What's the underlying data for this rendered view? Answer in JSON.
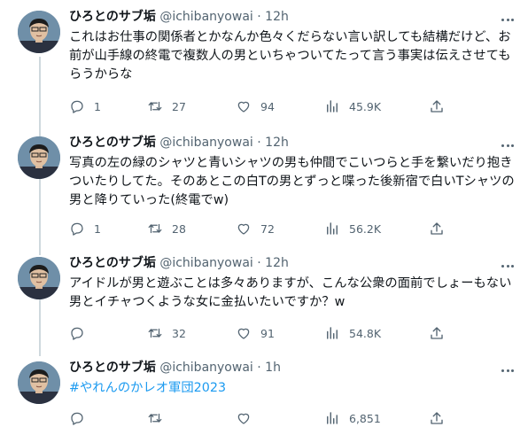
{
  "tweets": [
    {
      "name": "ひろとのサブ垢",
      "handle": "@ichibanyowai",
      "sep": "·",
      "time": "12h",
      "paragraphs": [
        "これはお仕事の関係者とかなんか色々くだらない言い訳しても結構だけど、お前が山手線の終電で複数人の男といちゃついてたって言う事実は伝えさせてもらうからな"
      ],
      "replies": "1",
      "retweets": "27",
      "likes": "94",
      "views": "45.9K"
    },
    {
      "name": "ひろとのサブ垢",
      "handle": "@ichibanyowai",
      "sep": "·",
      "time": "12h",
      "paragraphs": [
        "写真の左の緑のシャツと青いシャツの男も仲間でこいつらと手を繋いだり抱きついたりしてた。そのあとこの白Tの男とずっと喋った後新宿で白いTシャツの男と降りていった(終電でw)"
      ],
      "replies": "1",
      "retweets": "28",
      "likes": "72",
      "views": "56.2K"
    },
    {
      "name": "ひろとのサブ垢",
      "handle": "@ichibanyowai",
      "sep": "·",
      "time": "12h",
      "paragraphs": [
        "アイドルが男と遊ぶことは多々ありますが、こんな公衆の面前でしょーもない男とイチャつくような女に金払いたいですか？w"
      ],
      "replies": "",
      "retweets": "32",
      "likes": "91",
      "views": "54.8K"
    },
    {
      "name": "ひろとのサブ垢",
      "handle": "@ichibanyowai",
      "sep": "·",
      "time": "1h",
      "hashtag": "#やれんのかレオ軍団2023",
      "replies": "",
      "retweets": "",
      "likes": "",
      "views": "6,851"
    }
  ],
  "icons": {
    "reply": "reply-icon",
    "retweet": "retweet-icon",
    "like": "like-icon",
    "views": "views-icon",
    "share": "share-icon",
    "more": "more-icon"
  },
  "colors": {
    "text": "#0f1419",
    "secondary": "#536471",
    "link": "#1d9bf0",
    "thread_line": "#cfd9de"
  }
}
